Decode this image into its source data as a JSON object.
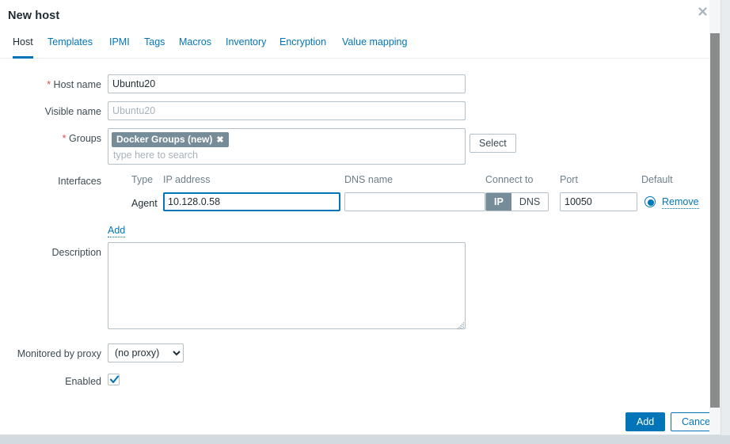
{
  "window": {
    "title": "New host",
    "close_icon": "close-icon"
  },
  "tabs": [
    {
      "label": "Host",
      "active": true
    },
    {
      "label": "Templates",
      "active": false
    },
    {
      "label": "IPMI",
      "active": false
    },
    {
      "label": "Tags",
      "active": false
    },
    {
      "label": "Macros",
      "active": false
    },
    {
      "label": "Inventory",
      "active": false
    },
    {
      "label": "Encryption",
      "active": false
    },
    {
      "label": "Value mapping",
      "active": false
    }
  ],
  "form": {
    "host_name": {
      "label": "Host name",
      "required": true,
      "value": "Ubuntu20",
      "placeholder": ""
    },
    "visible_name": {
      "label": "Visible name",
      "required": false,
      "value": "",
      "placeholder": "Ubuntu20"
    },
    "groups": {
      "label": "Groups",
      "required": true,
      "chips": [
        {
          "label": "Docker Groups (new)",
          "remove_icon": "remove-chip-icon"
        }
      ],
      "search_placeholder": "type here to search",
      "select_button": "Select"
    },
    "interfaces": {
      "label": "Interfaces",
      "columns": {
        "type": "Type",
        "ip_address": "IP address",
        "dns_name": "DNS name",
        "connect_to": "Connect to",
        "port": "Port",
        "default": "Default"
      },
      "rows": [
        {
          "type": "Agent",
          "ip_address": "10.128.0.58",
          "ip_focused": true,
          "dns_name": "",
          "connect_to_options": [
            "IP",
            "DNS"
          ],
          "connect_to_selected": "IP",
          "port": "10050",
          "default_selected": true,
          "remove_label": "Remove"
        }
      ],
      "add_label": "Add"
    },
    "description": {
      "label": "Description",
      "value": "",
      "placeholder": ""
    },
    "monitored_by_proxy": {
      "label": "Monitored by proxy",
      "value": "(no proxy)",
      "options": [
        "(no proxy)"
      ]
    },
    "enabled": {
      "label": "Enabled",
      "checked": true
    }
  },
  "footer": {
    "submit_label": "Add",
    "cancel_label": "Cancel"
  },
  "colors": {
    "accent": "#0275b8",
    "required_star": "#d85050",
    "chip_bg": "#768d99",
    "label_text": "#3e4b52",
    "border": "#b4bfc7"
  }
}
